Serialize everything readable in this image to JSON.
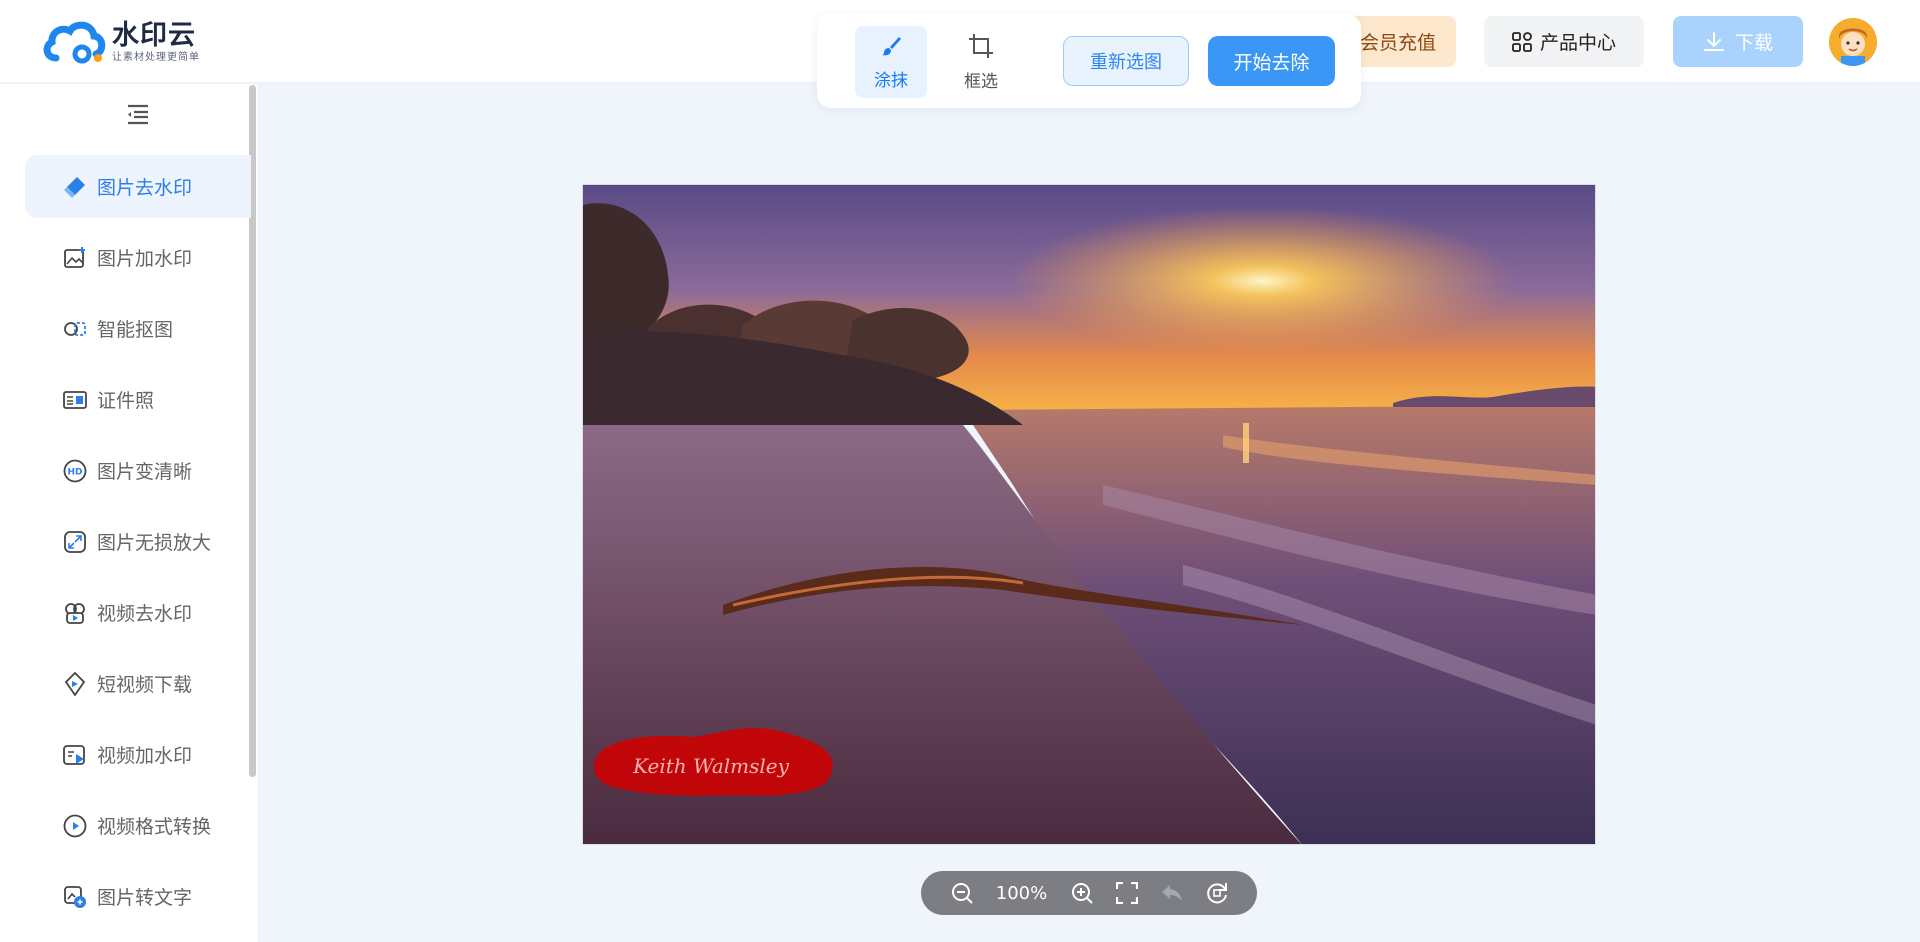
{
  "header": {
    "logo_name": "水印云",
    "logo_slogan": "让素材处理更简单",
    "vip_label": "会员充值",
    "products_label": "产品中心",
    "download_label": "下载"
  },
  "toolbar": {
    "tools": [
      {
        "label": "涂抹",
        "icon": "brush-icon",
        "active": true
      },
      {
        "label": "框选",
        "icon": "crop-icon",
        "active": false
      }
    ],
    "reselect_label": "重新选图",
    "start_label": "开始去除"
  },
  "sidebar": {
    "items": [
      {
        "label": "图片去水印",
        "icon": "eraser-icon",
        "active": true
      },
      {
        "label": "图片加水印",
        "icon": "image-add-icon"
      },
      {
        "label": "智能抠图",
        "icon": "cutout-icon"
      },
      {
        "label": "证件照",
        "icon": "id-card-icon"
      },
      {
        "label": "图片变清晰",
        "icon": "hd-icon"
      },
      {
        "label": "图片无损放大",
        "icon": "enlarge-icon"
      },
      {
        "label": "视频去水印",
        "icon": "video-eraser-icon"
      },
      {
        "label": "短视频下载",
        "icon": "video-download-icon"
      },
      {
        "label": "视频加水印",
        "icon": "video-add-icon"
      },
      {
        "label": "视频格式转换",
        "icon": "video-convert-icon"
      },
      {
        "label": "图片转文字",
        "icon": "ocr-icon"
      }
    ]
  },
  "canvas": {
    "watermark_text": "Keith Walmsley"
  },
  "zoom": {
    "value": "100%"
  },
  "colors": {
    "accent": "#3a97f6",
    "page_bg": "#f0f4fb",
    "vip_bg": "#fde7cd",
    "mask_red": "#d00000"
  }
}
